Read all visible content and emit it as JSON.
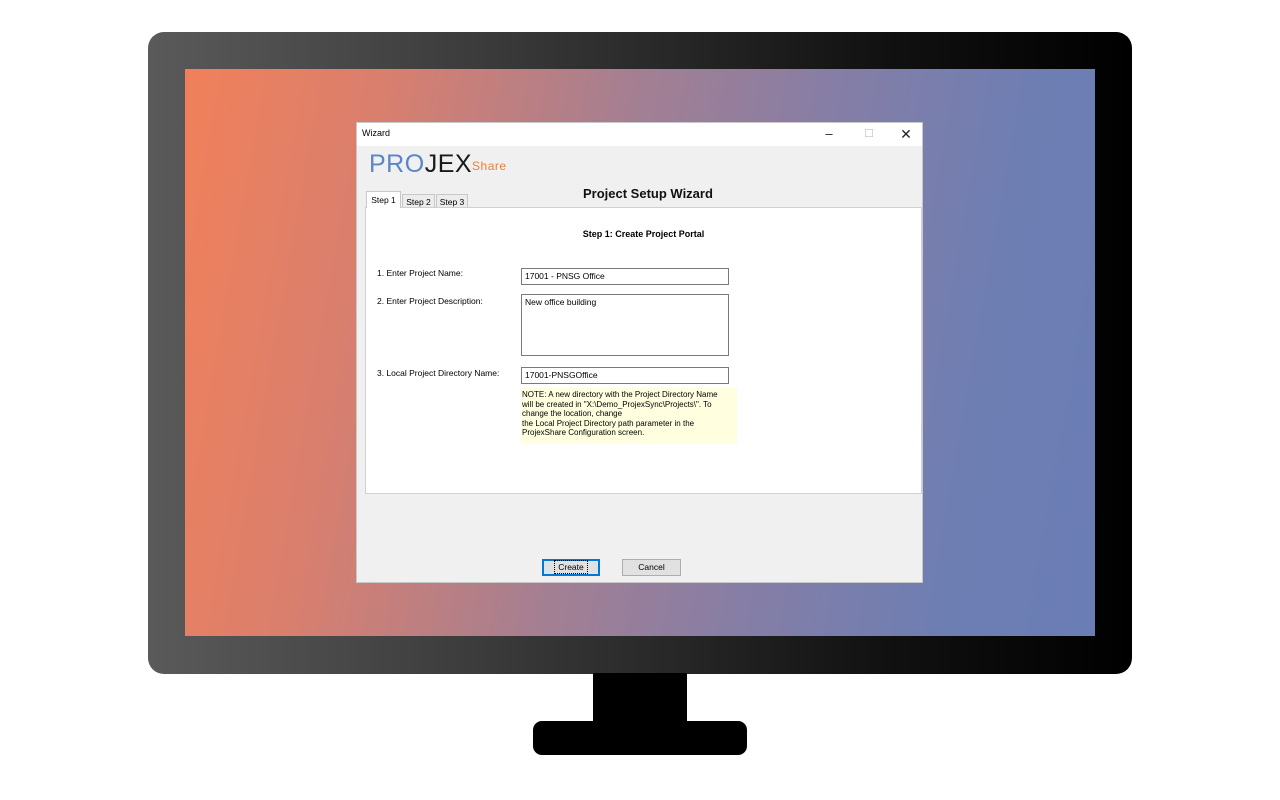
{
  "window": {
    "title": "Wizard",
    "minimize_glyph": "–",
    "maximize_glyph": "☐",
    "close_glyph": "✕"
  },
  "logo": {
    "part1": "PRO",
    "part2": "JEX",
    "part3": "Share"
  },
  "wizard_title": "Project Setup Wizard",
  "tabs": [
    {
      "label": "Step 1",
      "active": true
    },
    {
      "label": "Step 2",
      "active": false
    },
    {
      "label": "Step 3",
      "active": false
    }
  ],
  "step1": {
    "heading": "Step 1: Create Project Portal",
    "project_name_label": "1. Enter Project Name:",
    "project_name_value": "17001 - PNSG Office",
    "project_description_label": "2. Enter Project Description:",
    "project_description_value": "New office building",
    "local_dir_label": "3. Local Project Directory Name:",
    "local_dir_value": "17001-PNSGOffice",
    "note_lines": [
      "NOTE: A new directory with the Project Directory Name",
      "will be created in \"X:\\Demo_ProjexSync\\Projects\\\".  To",
      "change the location, change",
      "the Local Project Directory path parameter in the",
      "ProjexShare Configuration screen."
    ]
  },
  "buttons": {
    "create": "Create",
    "cancel": "Cancel"
  },
  "colors": {
    "logo_blue": "#5a86c6",
    "logo_orange": "#ef7d37",
    "note_background": "#ffffe0",
    "default_button_border": "#0078d7"
  }
}
